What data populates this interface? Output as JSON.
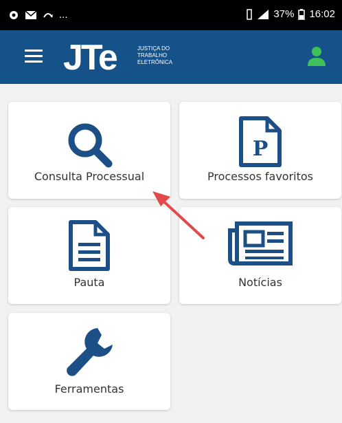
{
  "statusbar": {
    "battery": "37%",
    "time": "16:02",
    "dots": "..."
  },
  "header": {
    "logo_text": "JTe",
    "logo_subtext_1": "JUSTIÇA DO",
    "logo_subtext_2": "TRABALHO",
    "logo_subtext_3": "ELETRÔNICA"
  },
  "tiles": {
    "consulta": {
      "label": "Consulta Processual",
      "icon": "search-icon"
    },
    "favoritos": {
      "label": "Processos favoritos",
      "icon": "document-p-icon"
    },
    "pauta": {
      "label": "Pauta",
      "icon": "document-icon"
    },
    "noticias": {
      "label": "Notícias",
      "icon": "newspaper-icon"
    },
    "ferramentas": {
      "label": "Ferramentas",
      "icon": "wrench-icon"
    }
  },
  "colors": {
    "brand": "#16528a",
    "accent_green": "#3ec15a",
    "icon_blue": "#1b4f85",
    "arrow_red": "#e24a4a"
  }
}
